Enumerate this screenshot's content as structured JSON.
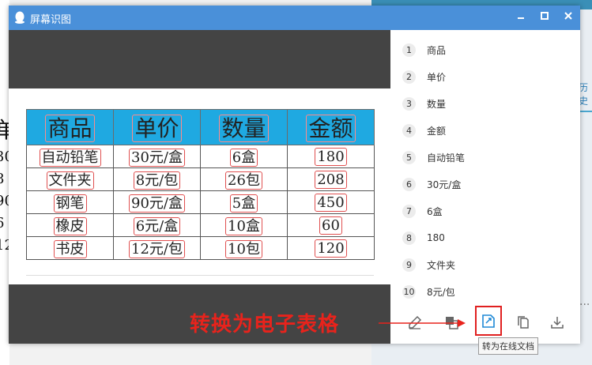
{
  "window": {
    "title": "屏幕识图"
  },
  "background": {
    "side_text": "历史",
    "dots": "···"
  },
  "left_fragment": [
    "单",
    "30",
    "8",
    "90",
    "6",
    "12"
  ],
  "table": {
    "headers": [
      "商品",
      "单价",
      "数量",
      "金额"
    ],
    "rows": [
      [
        "自动铅笔",
        "30元/盒",
        "6盒",
        "180"
      ],
      [
        "文件夹",
        "8元/包",
        "26包",
        "208"
      ],
      [
        "钢笔",
        "90元/盒",
        "5盒",
        "450"
      ],
      [
        "橡皮",
        "6元/盒",
        "10盒",
        "60"
      ],
      [
        "书皮",
        "12元/包",
        "10包",
        "120"
      ]
    ]
  },
  "results": [
    {
      "num": "1",
      "text": "商品"
    },
    {
      "num": "2",
      "text": "单价"
    },
    {
      "num": "3",
      "text": "数量"
    },
    {
      "num": "4",
      "text": "金额"
    },
    {
      "num": "5",
      "text": "自动铅笔"
    },
    {
      "num": "6",
      "text": "30元/盒"
    },
    {
      "num": "7",
      "text": "6盒"
    },
    {
      "num": "8",
      "text": "180"
    },
    {
      "num": "9",
      "text": "文件夹"
    },
    {
      "num": "10",
      "text": "8元/包"
    }
  ],
  "toolbar": {
    "icons": [
      "edit-icon",
      "translate-icon",
      "convert-online-doc-icon",
      "copy-icon",
      "download-icon"
    ],
    "tooltip": "转为在线文档"
  },
  "annotation": {
    "text": "转换为电子表格",
    "color": "#e8231c"
  },
  "colors": {
    "titlebar": "#4a90d9",
    "header_fill": "#1fa9e1",
    "highlight": "#e02020"
  }
}
